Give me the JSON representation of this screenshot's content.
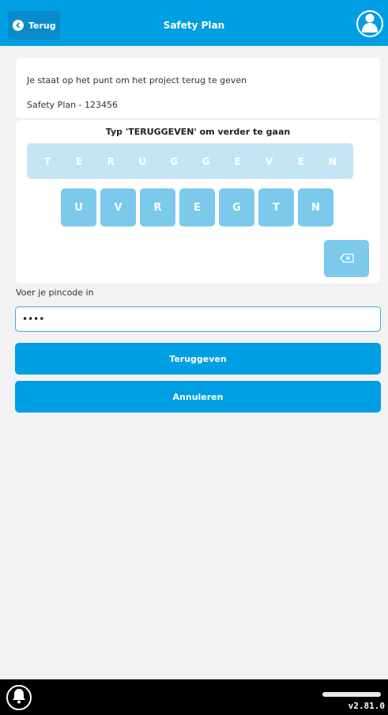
{
  "header": {
    "back_label": "Terug",
    "title": "Safety Plan",
    "back_icon": "chevron-left-icon",
    "user_icon": "user-icon",
    "color": "#009fe3"
  },
  "info": {
    "message": "Je staat op het punt om het project terug te geven",
    "plan": "Safety Plan - 123456"
  },
  "keyboard": {
    "instruction": "Typ 'TERUGGEVEN' om verder te gaan",
    "target_letters": [
      "T",
      "E",
      "R",
      "U",
      "G",
      "G",
      "E",
      "V",
      "E",
      "N"
    ],
    "keys": [
      "U",
      "V",
      "R",
      "E",
      "G",
      "T",
      "N"
    ],
    "backspace_icon": "backspace-icon"
  },
  "pin": {
    "label": "Voer je pincode in",
    "value": "••••"
  },
  "actions": {
    "return_label": "Teruggeven",
    "cancel_label": "Annuleren"
  },
  "footer": {
    "bell_icon": "bell-icon",
    "version": "v2.81.0"
  },
  "colors": {
    "primary": "#009fe3",
    "key": "#7cc9ec",
    "target_bar": "#c5e5f5",
    "background": "#f2f2f2"
  }
}
